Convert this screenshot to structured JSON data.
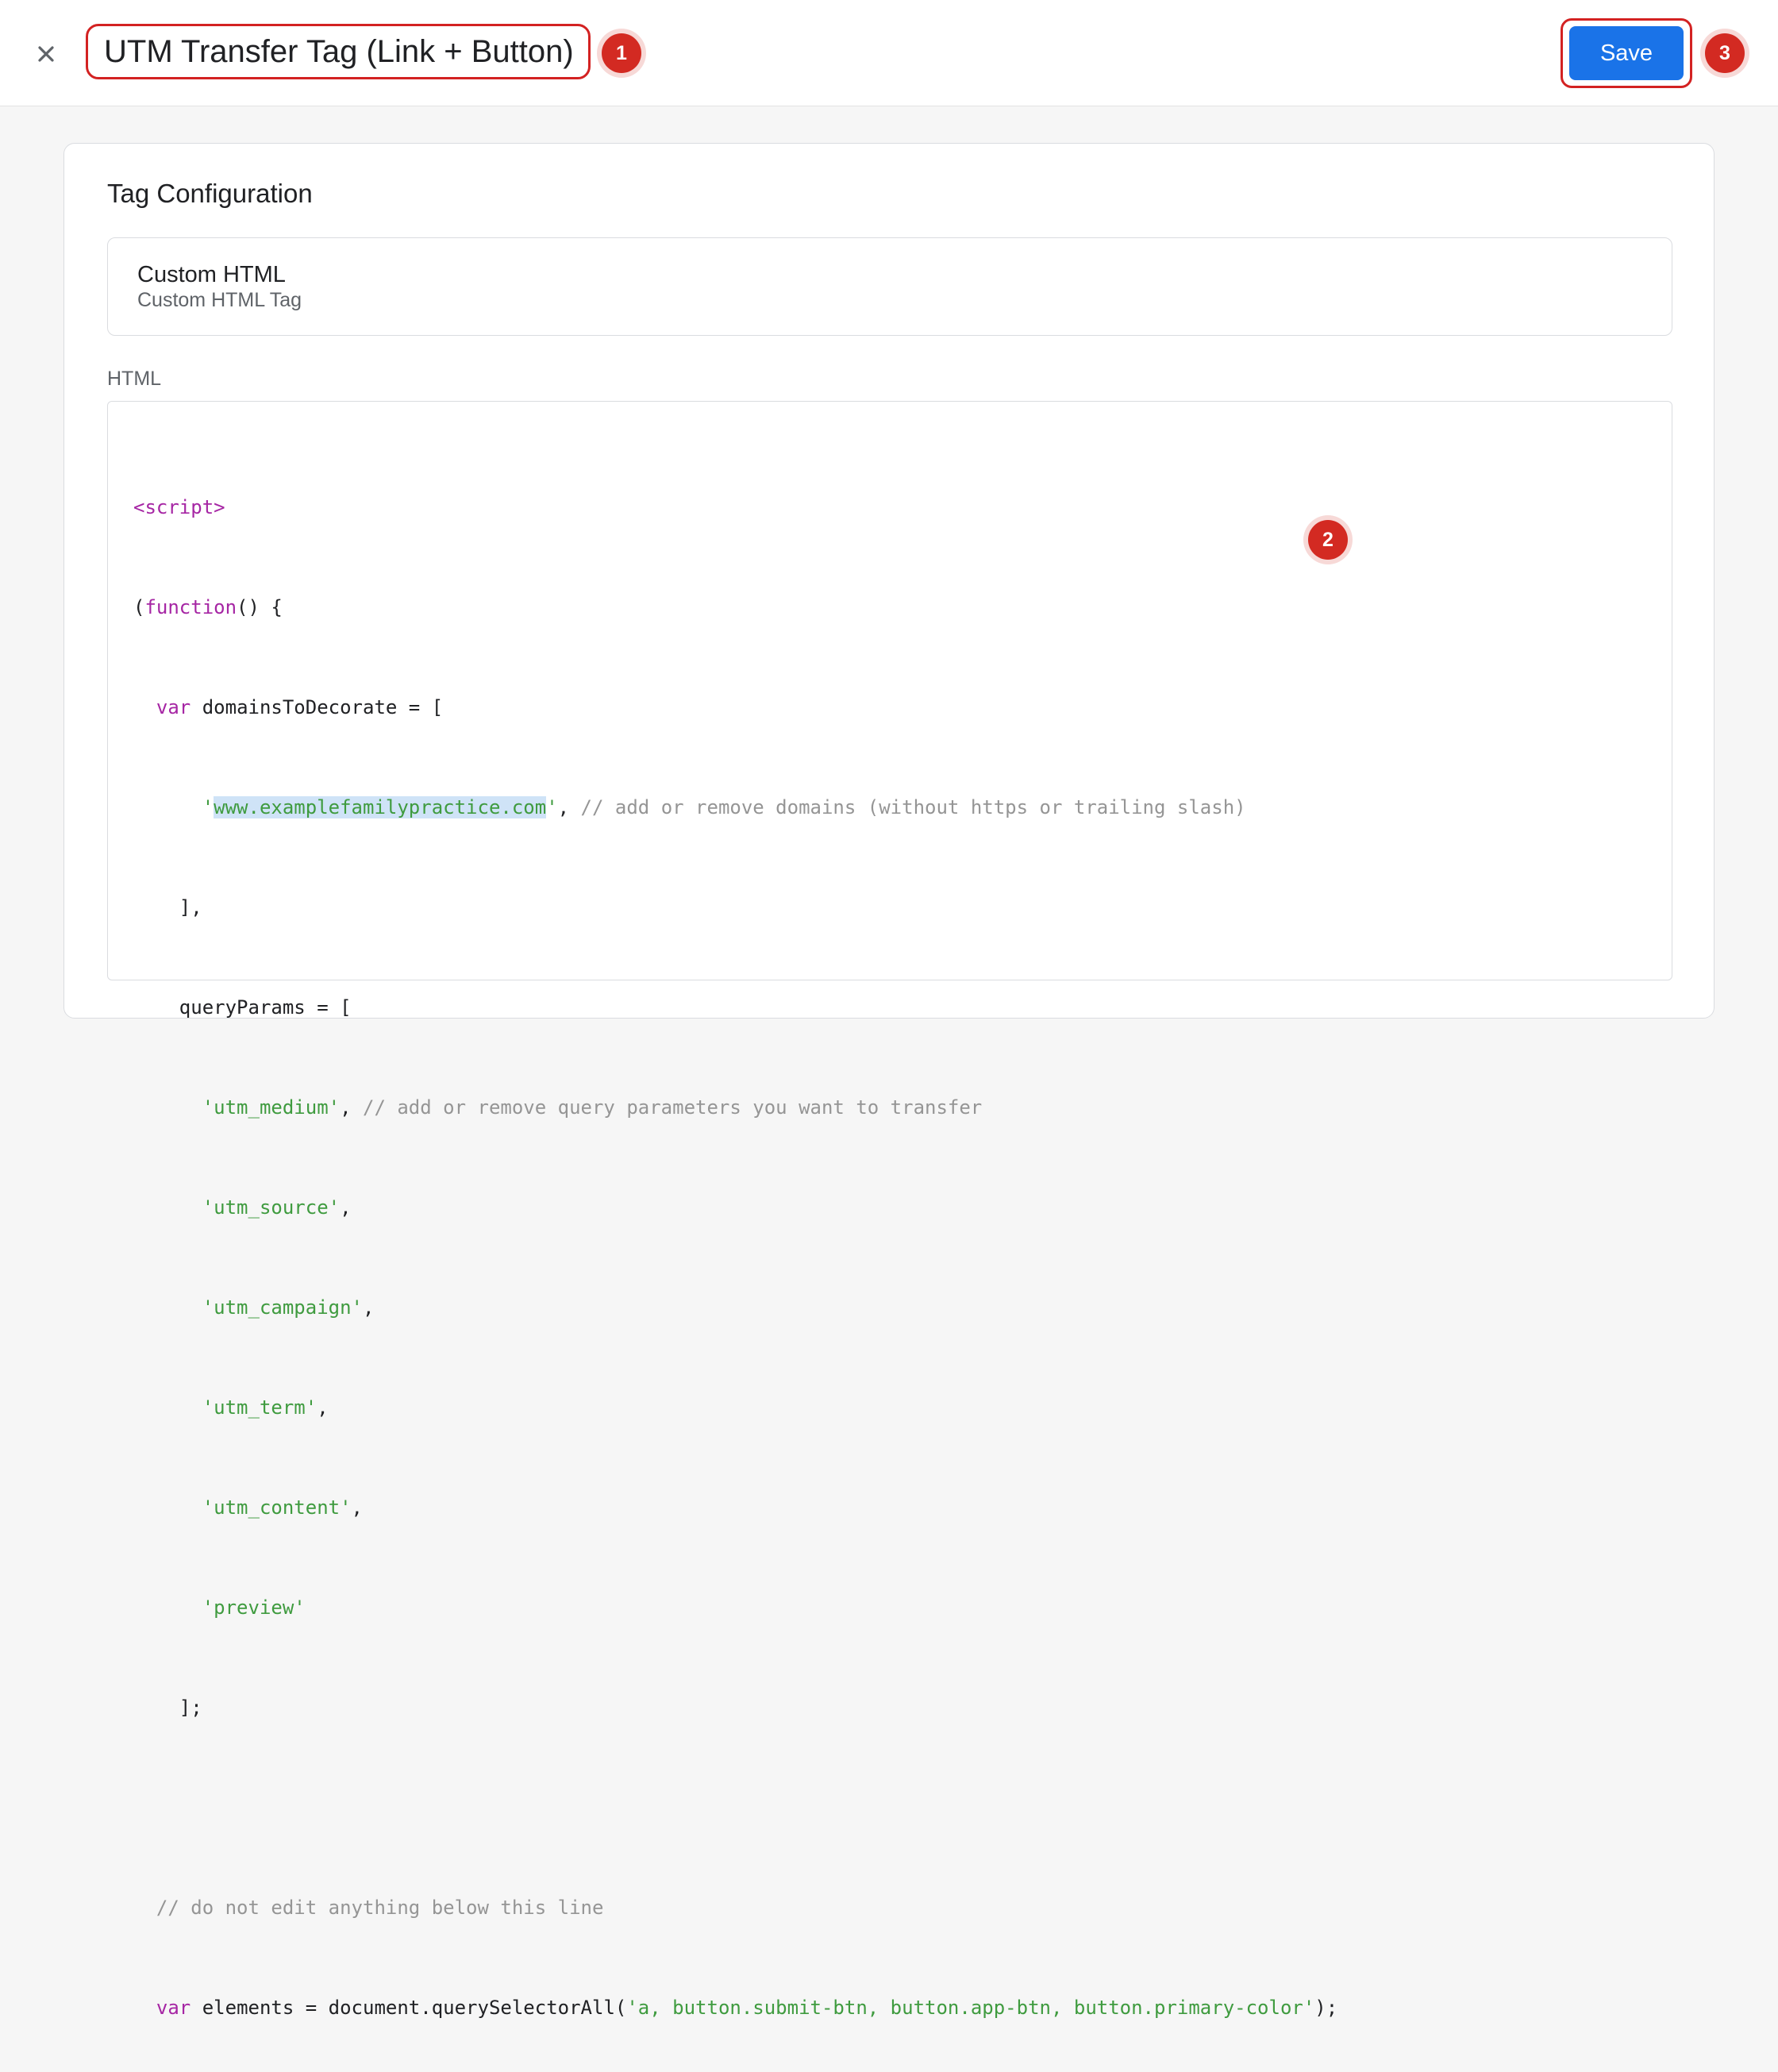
{
  "header": {
    "title": "UTM Transfer Tag (Link + Button)",
    "save_label": "Save",
    "close_icon": "close-icon",
    "badge_title": "1",
    "badge_code": "2",
    "badge_save": "3"
  },
  "config": {
    "section_title": "Tag Configuration",
    "tag_type_name": "Custom HTML",
    "tag_type_description": "Custom HTML Tag",
    "html_label": "HTML"
  },
  "code": {
    "l1_tag": "<script>",
    "l2_open": "(",
    "l2_kw": "function",
    "l2_rest": "() {",
    "l3_indent": "  ",
    "l3_kw": "var",
    "l3_rest": " domainsToDecorate = [",
    "l4_indent": "      ",
    "l4_q1": "'",
    "l4_domain": "www.examplefamilypractice.com",
    "l4_q2": "'",
    "l4_punct": ", ",
    "l4_comment": "// add or remove domains (without https or trailing slash)",
    "l5": "    ],",
    "l6": "    queryParams = [",
    "l7_indent": "      ",
    "l7_str": "'utm_medium'",
    "l7_punct": ", ",
    "l7_comment": "// add or remove query parameters you want to transfer",
    "l8_indent": "      ",
    "l8_str": "'utm_source'",
    "l8_punct": ",",
    "l9_indent": "      ",
    "l9_str": "'utm_campaign'",
    "l9_punct": ",",
    "l10_indent": "      ",
    "l10_str": "'utm_term'",
    "l10_punct": ",",
    "l11_indent": "      ",
    "l11_str": "'utm_content'",
    "l11_punct": ",",
    "l12_indent": "      ",
    "l12_str": "'preview'",
    "l13": "    ];",
    "l15_indent": "  ",
    "l15_comment": "// do not edit anything below this line",
    "l16_indent": "  ",
    "l16_kw": "var",
    "l16_rest": " elements = document.querySelectorAll(",
    "l16_str": "'a, button.submit-btn, button.app-btn, button.primary-color'",
    "l16_end": ");"
  },
  "colors": {
    "accent": "#1a73e8",
    "annotation_red": "#d32a22"
  }
}
